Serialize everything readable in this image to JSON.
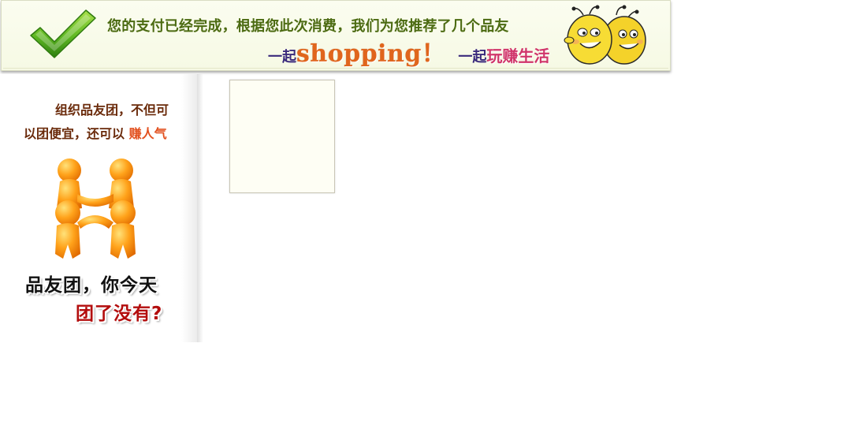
{
  "banner": {
    "message": "您的支付已经完成，根据您此次消费，我们为您推荐了几个品友",
    "slogan_prefix_1": "一起",
    "slogan_shopping": "shopping！",
    "slogan_prefix_2": "一起",
    "slogan_tail": "玩赚生活",
    "check_icon": "checkmark-icon",
    "mascot_icon": "bees-mascot-icon"
  },
  "promo": {
    "line1": "组织品友团，不但可",
    "line2_text": "以团便宜，还可以",
    "line2_highlight": "赚人气",
    "title_line1": "品友团，你今天",
    "title_line2": "团了没有?",
    "people_icon": "team-people-icon"
  },
  "colors": {
    "banner_text": "#4c6b12",
    "shopping": "#e0651c",
    "slogan_purple": "#3a2a7c",
    "slogan_red": "#d0356a",
    "promo_text": "#6a2a0a",
    "highlight": "#e2501e",
    "title_red": "#b30d0d"
  }
}
